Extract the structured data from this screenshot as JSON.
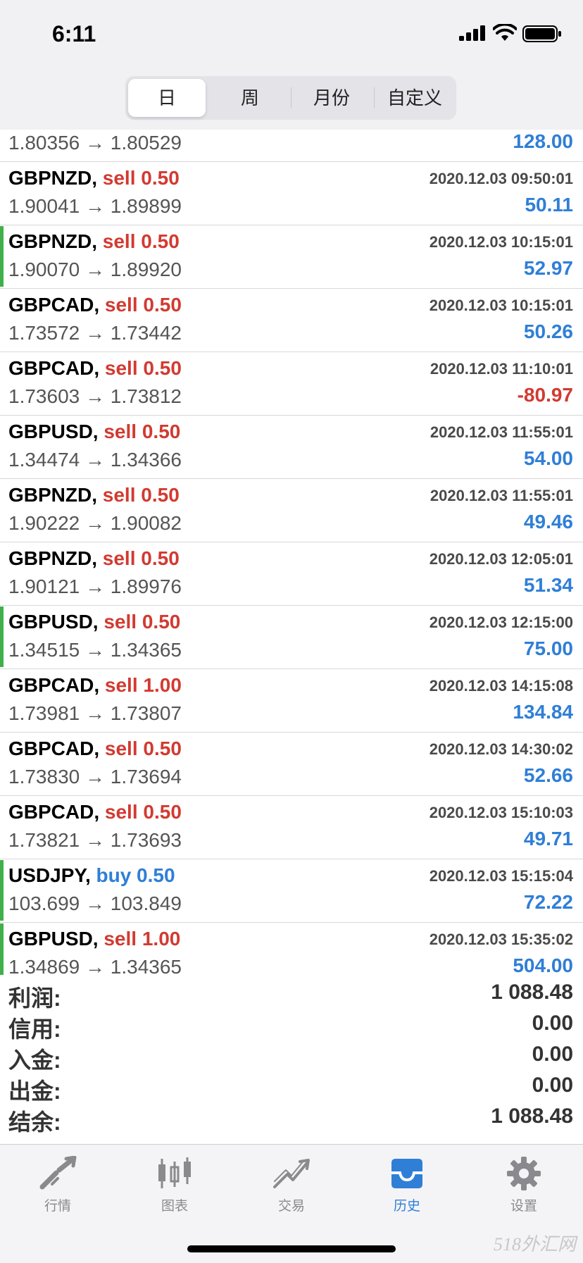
{
  "status_bar": {
    "time": "6:11"
  },
  "segments": [
    {
      "label": "日",
      "active": true
    },
    {
      "label": "周",
      "active": false
    },
    {
      "label": "月份",
      "active": false
    },
    {
      "label": "自定义",
      "active": false
    }
  ],
  "partial_row": {
    "prices": "1.80356 → 1.80529",
    "profit": "128.00"
  },
  "trades": [
    {
      "symbol": "GBPNZD,",
      "side": "sell 0.50",
      "type": "sell",
      "datetime": "2020.12.03 09:50:01",
      "prices": "1.90041 → 1.89899",
      "profit": "50.11",
      "negative": false,
      "marker": false
    },
    {
      "symbol": "GBPNZD,",
      "side": "sell 0.50",
      "type": "sell",
      "datetime": "2020.12.03 10:15:01",
      "prices": "1.90070 → 1.89920",
      "profit": "52.97",
      "negative": false,
      "marker": true
    },
    {
      "symbol": "GBPCAD,",
      "side": "sell 0.50",
      "type": "sell",
      "datetime": "2020.12.03 10:15:01",
      "prices": "1.73572 → 1.73442",
      "profit": "50.26",
      "negative": false,
      "marker": false
    },
    {
      "symbol": "GBPCAD,",
      "side": "sell 0.50",
      "type": "sell",
      "datetime": "2020.12.03 11:10:01",
      "prices": "1.73603 → 1.73812",
      "profit": "-80.97",
      "negative": true,
      "marker": false
    },
    {
      "symbol": "GBPUSD,",
      "side": "sell 0.50",
      "type": "sell",
      "datetime": "2020.12.03 11:55:01",
      "prices": "1.34474 → 1.34366",
      "profit": "54.00",
      "negative": false,
      "marker": false
    },
    {
      "symbol": "GBPNZD,",
      "side": "sell 0.50",
      "type": "sell",
      "datetime": "2020.12.03 11:55:01",
      "prices": "1.90222 → 1.90082",
      "profit": "49.46",
      "negative": false,
      "marker": false
    },
    {
      "symbol": "GBPNZD,",
      "side": "sell 0.50",
      "type": "sell",
      "datetime": "2020.12.03 12:05:01",
      "prices": "1.90121 → 1.89976",
      "profit": "51.34",
      "negative": false,
      "marker": false
    },
    {
      "symbol": "GBPUSD,",
      "side": "sell 0.50",
      "type": "sell",
      "datetime": "2020.12.03 12:15:00",
      "prices": "1.34515 → 1.34365",
      "profit": "75.00",
      "negative": false,
      "marker": true
    },
    {
      "symbol": "GBPCAD,",
      "side": "sell 1.00",
      "type": "sell",
      "datetime": "2020.12.03 14:15:08",
      "prices": "1.73981 → 1.73807",
      "profit": "134.84",
      "negative": false,
      "marker": false
    },
    {
      "symbol": "GBPCAD,",
      "side": "sell 0.50",
      "type": "sell",
      "datetime": "2020.12.03 14:30:02",
      "prices": "1.73830 → 1.73694",
      "profit": "52.66",
      "negative": false,
      "marker": false
    },
    {
      "symbol": "GBPCAD,",
      "side": "sell 0.50",
      "type": "sell",
      "datetime": "2020.12.03 15:10:03",
      "prices": "1.73821 → 1.73693",
      "profit": "49.71",
      "negative": false,
      "marker": false
    },
    {
      "symbol": "USDJPY,",
      "side": "buy 0.50",
      "type": "buy",
      "datetime": "2020.12.03 15:15:04",
      "prices": "103.699 → 103.849",
      "profit": "72.22",
      "negative": false,
      "marker": true
    },
    {
      "symbol": "GBPUSD,",
      "side": "sell 1.00",
      "type": "sell",
      "datetime": "2020.12.03 15:35:02",
      "prices": "1.34869 → 1.34365",
      "profit": "504.00",
      "negative": false,
      "marker": true
    }
  ],
  "summary": [
    {
      "label": "利润:",
      "value": "1 088.48"
    },
    {
      "label": "信用:",
      "value": "0.00"
    },
    {
      "label": "入金:",
      "value": "0.00"
    },
    {
      "label": "出金:",
      "value": "0.00"
    },
    {
      "label": "结余:",
      "value": "1 088.48"
    }
  ],
  "tabs": [
    {
      "label": "行情",
      "icon": "quotes-icon",
      "active": false
    },
    {
      "label": "图表",
      "icon": "chart-icon",
      "active": false
    },
    {
      "label": "交易",
      "icon": "trade-icon",
      "active": false
    },
    {
      "label": "历史",
      "icon": "history-icon",
      "active": true
    },
    {
      "label": "设置",
      "icon": "settings-icon",
      "active": false
    }
  ],
  "watermark": "518外汇网",
  "colors": {
    "sell": "#d23a31",
    "buy": "#2f7fd6",
    "profit_positive": "#2f7fd6",
    "profit_negative": "#d23a31",
    "marker": "#3fb04a"
  }
}
